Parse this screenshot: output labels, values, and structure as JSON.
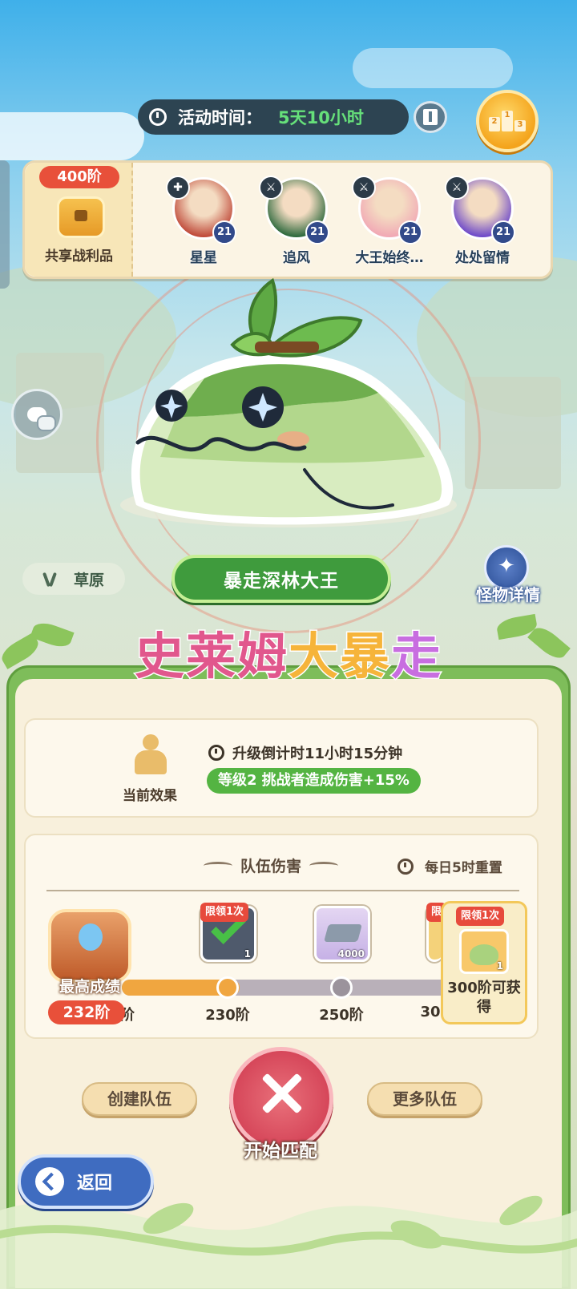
{
  "event": {
    "timer_label": "活动时间：",
    "timer_value": "5天10小时",
    "rank_digits": [
      "2",
      "1",
      "3"
    ]
  },
  "shared_loot": {
    "tier": "400阶",
    "label": "共享战利品"
  },
  "team_members": [
    {
      "name": "星星",
      "level": "21",
      "role_icon": "shield-icon",
      "avatar_color": "#c04a3a"
    },
    {
      "name": "追风",
      "level": "21",
      "role_icon": "sword-icon",
      "avatar_color": "#2f6a3e"
    },
    {
      "name": "大王始终…",
      "level": "21",
      "role_icon": "sword-icon",
      "avatar_color": "#f1a9b5"
    },
    {
      "name": "处处留情",
      "level": "21",
      "role_icon": "sword-icon",
      "avatar_color": "#6e4ac9"
    }
  ],
  "boss": {
    "name": "暴走深林大王",
    "biome": "草原",
    "details_label": "怪物详情"
  },
  "banner": {
    "part_a": "史莱姆",
    "part_b": "大暴",
    "part_c": "走"
  },
  "current_effect": {
    "label": "当前效果",
    "countdown": "升级倒计时11小时15分钟",
    "buff": "等级2  挑战者造成伤害+15%"
  },
  "team_damage": {
    "title": "队伍伤害",
    "reset_note": "每日5时重置",
    "best_label": "最高成绩",
    "best_tier": "232阶",
    "progress_to_next": 0.35,
    "milestones": [
      {
        "label": "230阶",
        "tag": "限领1次",
        "qty": "1",
        "claimed": true,
        "icon": "claimed-chest-icon"
      },
      {
        "label": "250阶",
        "tag": "",
        "qty": "4000",
        "claimed": false,
        "icon": "silver-ingot-icon"
      },
      {
        "label": "30",
        "tag": "限",
        "qty": "",
        "claimed": false,
        "icon": "slime-egg-icon"
      }
    ],
    "cut_left_label": "阶",
    "next_reward": {
      "tag": "限领1次",
      "qty": "1",
      "label": "300阶可获得",
      "icon": "slime-egg-icon"
    }
  },
  "actions": {
    "create_team": "创建队伍",
    "more_teams": "更多队伍",
    "start_match": "开始匹配",
    "back": "返回"
  },
  "colors": {
    "accent_green": "#3f9b3d",
    "tier_red": "#e8503a",
    "progress_orange": "#f0a640",
    "back_blue": "#3f6cc0"
  }
}
